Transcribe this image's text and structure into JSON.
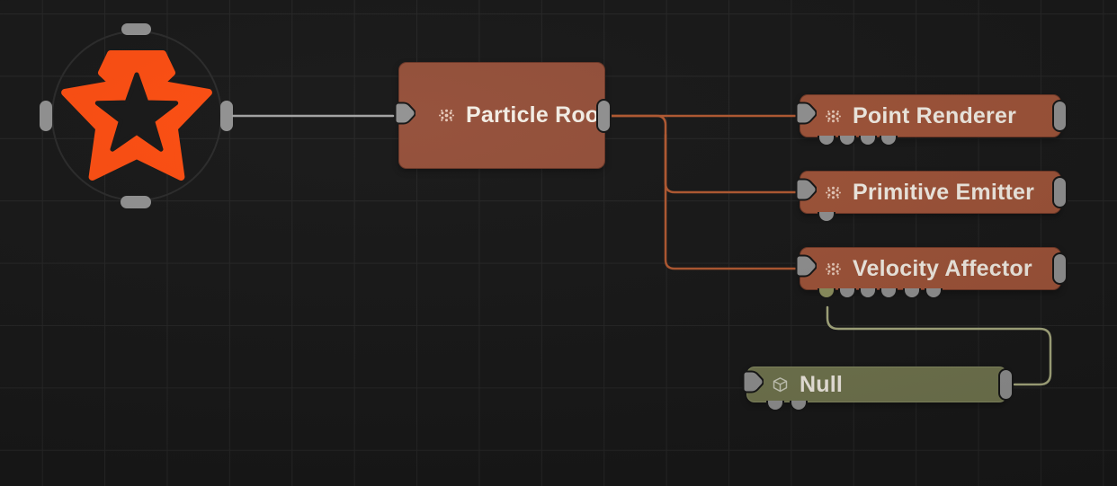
{
  "editor": {
    "background_color": "#181818",
    "grid_color": "#262626",
    "accent_color": "#ff4e11"
  },
  "start_node": {
    "id": "start",
    "icon": "star-logo-icon",
    "color": "#ff4e11",
    "ports": [
      "top",
      "left",
      "right",
      "bottom"
    ]
  },
  "nodes": [
    {
      "id": "particle-root",
      "label": "Particle Root",
      "icon": "particles-icon",
      "fill": "#95503a",
      "bottom_ports": 0
    },
    {
      "id": "point-renderer",
      "label": "Point Renderer",
      "icon": "particles-icon",
      "fill": "#a05439",
      "bottom_ports": 4
    },
    {
      "id": "primitive-emitter",
      "label": "Primitive Emitter",
      "icon": "particles-icon",
      "fill": "#a05439",
      "bottom_ports": 1
    },
    {
      "id": "velocity-affector",
      "label": "Velocity Affector",
      "icon": "particles-icon",
      "fill": "#a05439",
      "bottom_ports": 6
    },
    {
      "id": "null-node",
      "label": "Null",
      "icon": "cube-icon",
      "fill": "#72764f",
      "bottom_ports": 2
    }
  ],
  "connections": [
    {
      "from": "start",
      "to": "particle-root",
      "color": "#a3a3a3"
    },
    {
      "from": "particle-root",
      "to": "point-renderer",
      "color": "#b25931"
    },
    {
      "from": "particle-root",
      "to": "primitive-emitter",
      "color": "#b25931"
    },
    {
      "from": "particle-root",
      "to": "velocity-affector",
      "color": "#b25931"
    },
    {
      "from": "null-node",
      "to": "velocity-affector",
      "color": "#a8ab80"
    }
  ]
}
